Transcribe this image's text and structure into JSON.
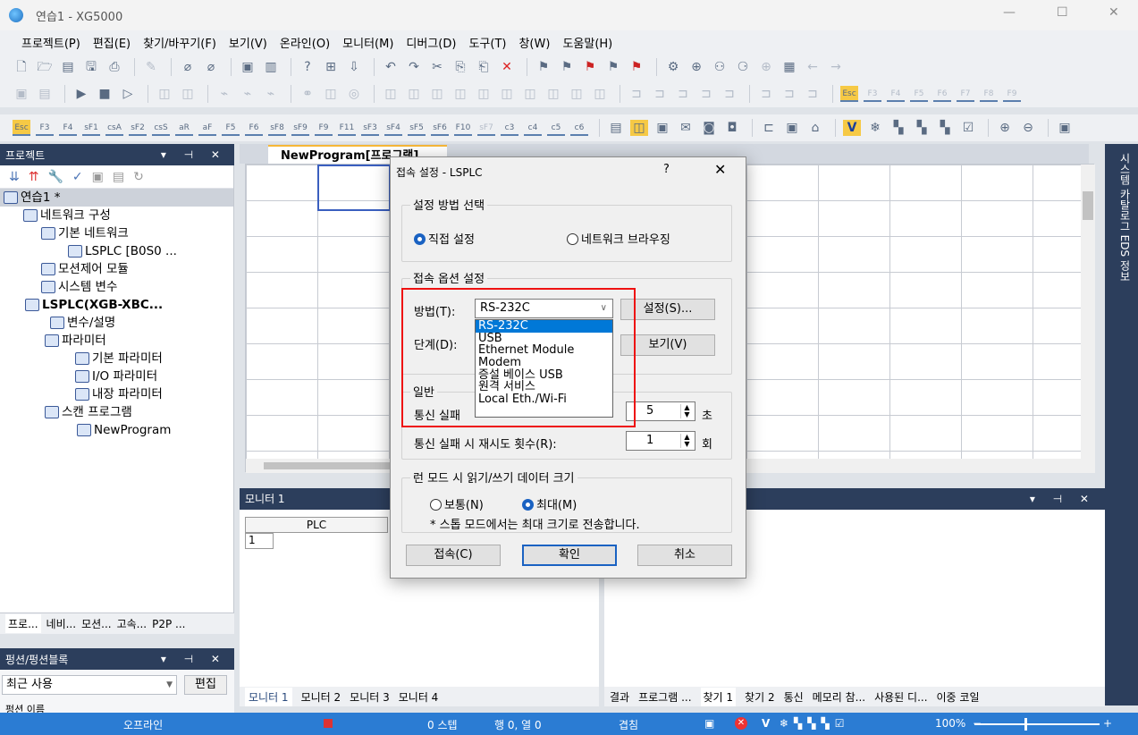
{
  "app": {
    "title": "연습1 - XG5000"
  },
  "menu": [
    "프로젝트(P)",
    "편집(E)",
    "찾기/바꾸기(F)",
    "보기(V)",
    "온라인(O)",
    "모니터(M)",
    "디버그(D)",
    "도구(T)",
    "창(W)",
    "도움말(H)"
  ],
  "project": {
    "header": "프로젝트",
    "tree": [
      {
        "label": "연습1 *",
        "indent": 0,
        "hl": true
      },
      {
        "label": "네트워크 구성",
        "indent": 1
      },
      {
        "label": "기본 네트워크",
        "indent": 2
      },
      {
        "label": "LSPLC [B0S0 ...",
        "indent": 3
      },
      {
        "label": "모션제어 모듈",
        "indent": 1
      },
      {
        "label": "시스템 변수",
        "indent": 1
      },
      {
        "label": "LSPLC(XGB-XBC...",
        "indent": 1,
        "bold": true
      },
      {
        "label": "변수/설명",
        "indent": 2
      },
      {
        "label": "파라미터",
        "indent": 2
      },
      {
        "label": "기본 파라미터",
        "indent": 3
      },
      {
        "label": "I/O 파라미터",
        "indent": 3
      },
      {
        "label": "내장 파라미터",
        "indent": 3
      },
      {
        "label": "스캔 프로그램",
        "indent": 2
      },
      {
        "label": "NewProgram",
        "indent": 3
      }
    ],
    "tabs": [
      "프로...",
      "네비...",
      "모션...",
      "고속...",
      "P2P ..."
    ]
  },
  "function": {
    "header": "펑션/펑션블록",
    "recent": "최근 사용",
    "edit": "편집",
    "below": "펑션 이름"
  },
  "editor": {
    "tab": "NewProgram[프로그램]"
  },
  "side_vtab": "시스템 카탈로그  EDS 정보",
  "monitor": {
    "header": "모니터 1",
    "col": "PLC",
    "row": "1",
    "tabs": [
      "모니터 1",
      "모니터 2",
      "모니터 3",
      "모니터 4"
    ]
  },
  "results": {
    "tabs": [
      "결과",
      "프로그램 ...",
      "찾기 1",
      "찾기 2",
      "통신",
      "메모리 참...",
      "사용된 디...",
      "이중 코일"
    ]
  },
  "status": {
    "mode": "오프라인",
    "steps": "0 스텝",
    "pos": "행 0, 열 0",
    "overwrite": "겹침",
    "zoom": "100%"
  },
  "dialog": {
    "title": "접속 설정 - LSPLC",
    "help": "?",
    "close": "✕",
    "group_method": "설정 방법 선택",
    "radio_direct": "직접 설정",
    "radio_browse": "네트워크 브라우징",
    "group_option": "접속 옵션 설정",
    "method_label": "방법(T):",
    "method_value": "RS-232C",
    "settings_btn": "설정(S)...",
    "step_label": "단계(D):",
    "view_btn": "보기(V)",
    "options": [
      "RS-232C",
      "USB",
      "Ethernet Module",
      "Modem",
      "증설 베이스 USB",
      "원격 서비스",
      "Local Eth./Wi-Fi"
    ],
    "group_general": "일반",
    "timeout_label": "통신 실패",
    "timeout_value": "5",
    "timeout_unit": "초",
    "retry_label": "통신 실패 시 재시도 횟수(R):",
    "retry_value": "1",
    "retry_unit": "회",
    "group_size": "런 모드 시 읽기/쓰기 데이터 크기",
    "radio_normal": "보통(N)",
    "radio_max": "최대(M)",
    "note": "* 스톱 모드에서는 최대 크기로 전송합니다.",
    "connect_btn": "접속(C)",
    "ok_btn": "확인",
    "cancel_btn": "취소"
  },
  "colors": {
    "accent": "#1a62c2",
    "panel_head": "#2c3e5c",
    "status": "#2b7cd3",
    "highlight": "#ee1111"
  }
}
